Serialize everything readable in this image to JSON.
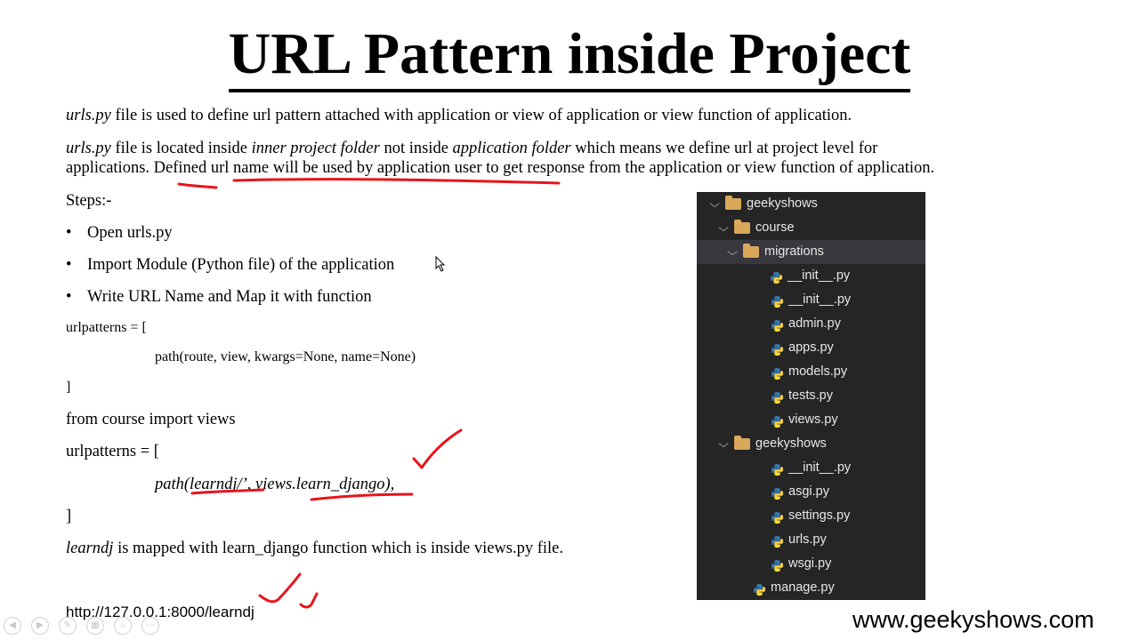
{
  "title": "URL Pattern inside Project",
  "para1": {
    "file": "urls.py",
    "text": " file is used to define url pattern attached with application or view of application or view function of application."
  },
  "para2": {
    "file": "urls.py",
    "t1": " file is located inside ",
    "inner": "inner project folder",
    "t2": " not inside ",
    "app": "application folder",
    "t3": " which means we define url at project level for",
    "line2": "applications. Defined url name will be used by application user to get response from the application or view function of application."
  },
  "steps_heading": "Steps:-",
  "steps": [
    "Open urls.py",
    "Import Module (Python file) of the application",
    "Write URL Name and Map it with function"
  ],
  "code1": {
    "open": "urlpatterns = [",
    "body": "path(route, view, kwargs=None, name=None)",
    "close": "]"
  },
  "import_line": "from course import views",
  "code2": {
    "open": "urlpatterns = [",
    "body": "path(learndj/’, views.learn_django),",
    "close": "]"
  },
  "mapping": {
    "term": "learndj",
    "text": " is mapped with learn_django function which is inside views.py file."
  },
  "url": "http://127.0.0.1:8000/learndj",
  "website": "www.geekyshows.com",
  "colors": {
    "tree_bg": "#252526",
    "folder": "#d9a85b",
    "python_blue": "#3776ab",
    "python_yellow": "#ffd43b",
    "annotation": "#e8141c"
  },
  "tree": [
    {
      "label": "geekyshows",
      "type": "folder",
      "expanded": true,
      "depth": 0
    },
    {
      "label": "course",
      "type": "folder",
      "expanded": true,
      "depth": 1
    },
    {
      "label": "migrations",
      "type": "folder",
      "expanded": true,
      "depth": 2,
      "selected": true
    },
    {
      "label": "__init__.py",
      "type": "python-file",
      "depth": 3
    },
    {
      "label": "__init__.py",
      "type": "python-file",
      "depth": 2
    },
    {
      "label": "admin.py",
      "type": "python-file",
      "depth": 2
    },
    {
      "label": "apps.py",
      "type": "python-file",
      "depth": 2
    },
    {
      "label": "models.py",
      "type": "python-file",
      "depth": 2
    },
    {
      "label": "tests.py",
      "type": "python-file",
      "depth": 2
    },
    {
      "label": "views.py",
      "type": "python-file",
      "depth": 2
    },
    {
      "label": "geekyshows",
      "type": "folder",
      "expanded": true,
      "depth": 1
    },
    {
      "label": "__init__.py",
      "type": "python-file",
      "depth": 2
    },
    {
      "label": "asgi.py",
      "type": "python-file",
      "depth": 2
    },
    {
      "label": "settings.py",
      "type": "python-file",
      "depth": 2
    },
    {
      "label": "urls.py",
      "type": "python-file",
      "depth": 2
    },
    {
      "label": "wsgi.py",
      "type": "python-file",
      "depth": 2
    },
    {
      "label": "manage.py",
      "type": "python-file",
      "depth": 1
    }
  ],
  "player_controls": [
    "prev-icon",
    "next-icon",
    "pen-icon",
    "slides-icon",
    "zoom-icon",
    "more-icon"
  ]
}
